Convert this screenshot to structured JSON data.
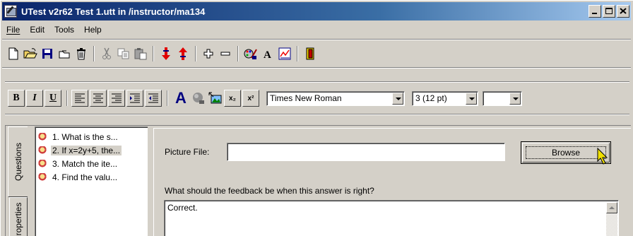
{
  "window": {
    "title": "UTest v2r62 Test 1.utt in /instructor/ma134",
    "controls": {
      "minimize": "_",
      "maximize": "□",
      "close": "×"
    }
  },
  "menu": {
    "items": [
      {
        "label": "File",
        "key": "F"
      },
      {
        "label": "Edit",
        "key": "E"
      },
      {
        "label": "Tools",
        "key": "T"
      },
      {
        "label": "Help",
        "key": "H"
      }
    ]
  },
  "toolbar": {
    "icons": [
      "new-file-icon",
      "open-folder-icon",
      "save-disk-icon",
      "open-icon",
      "delete-trash-icon",
      "cut-icon",
      "copy-icon",
      "paste-icon",
      "move-down-icon",
      "move-up-icon",
      "add-icon",
      "remove-icon",
      "colors-icon",
      "font-icon",
      "chart-icon",
      "exit-icon"
    ]
  },
  "format_toolbar": {
    "bold": "B",
    "italic": "I",
    "underline": "U",
    "font_color_label": "A",
    "subscript": "x₂",
    "superscript": "x²",
    "font_name": "Times New Roman",
    "font_size": "3 (12 pt)",
    "extra_value": ""
  },
  "side_tabs": {
    "questions": "Questions",
    "properties": "Properties"
  },
  "questions": [
    {
      "label": "1. What is the s...",
      "selected": false
    },
    {
      "label": "2. If x=2y+5, the...",
      "selected": true
    },
    {
      "label": "3. Match the ite...",
      "selected": false
    },
    {
      "label": "4. Find the valu...",
      "selected": false
    }
  ],
  "editor": {
    "picture_label": "Picture File:",
    "picture_value": "",
    "browse_label": "Browse",
    "feedback_prompt": "What should the feedback be when this answer is right?",
    "feedback_value": "Correct."
  },
  "colors": {
    "title_start": "#0a246a",
    "title_end": "#a6caf0",
    "face": "#d4d0c8"
  }
}
